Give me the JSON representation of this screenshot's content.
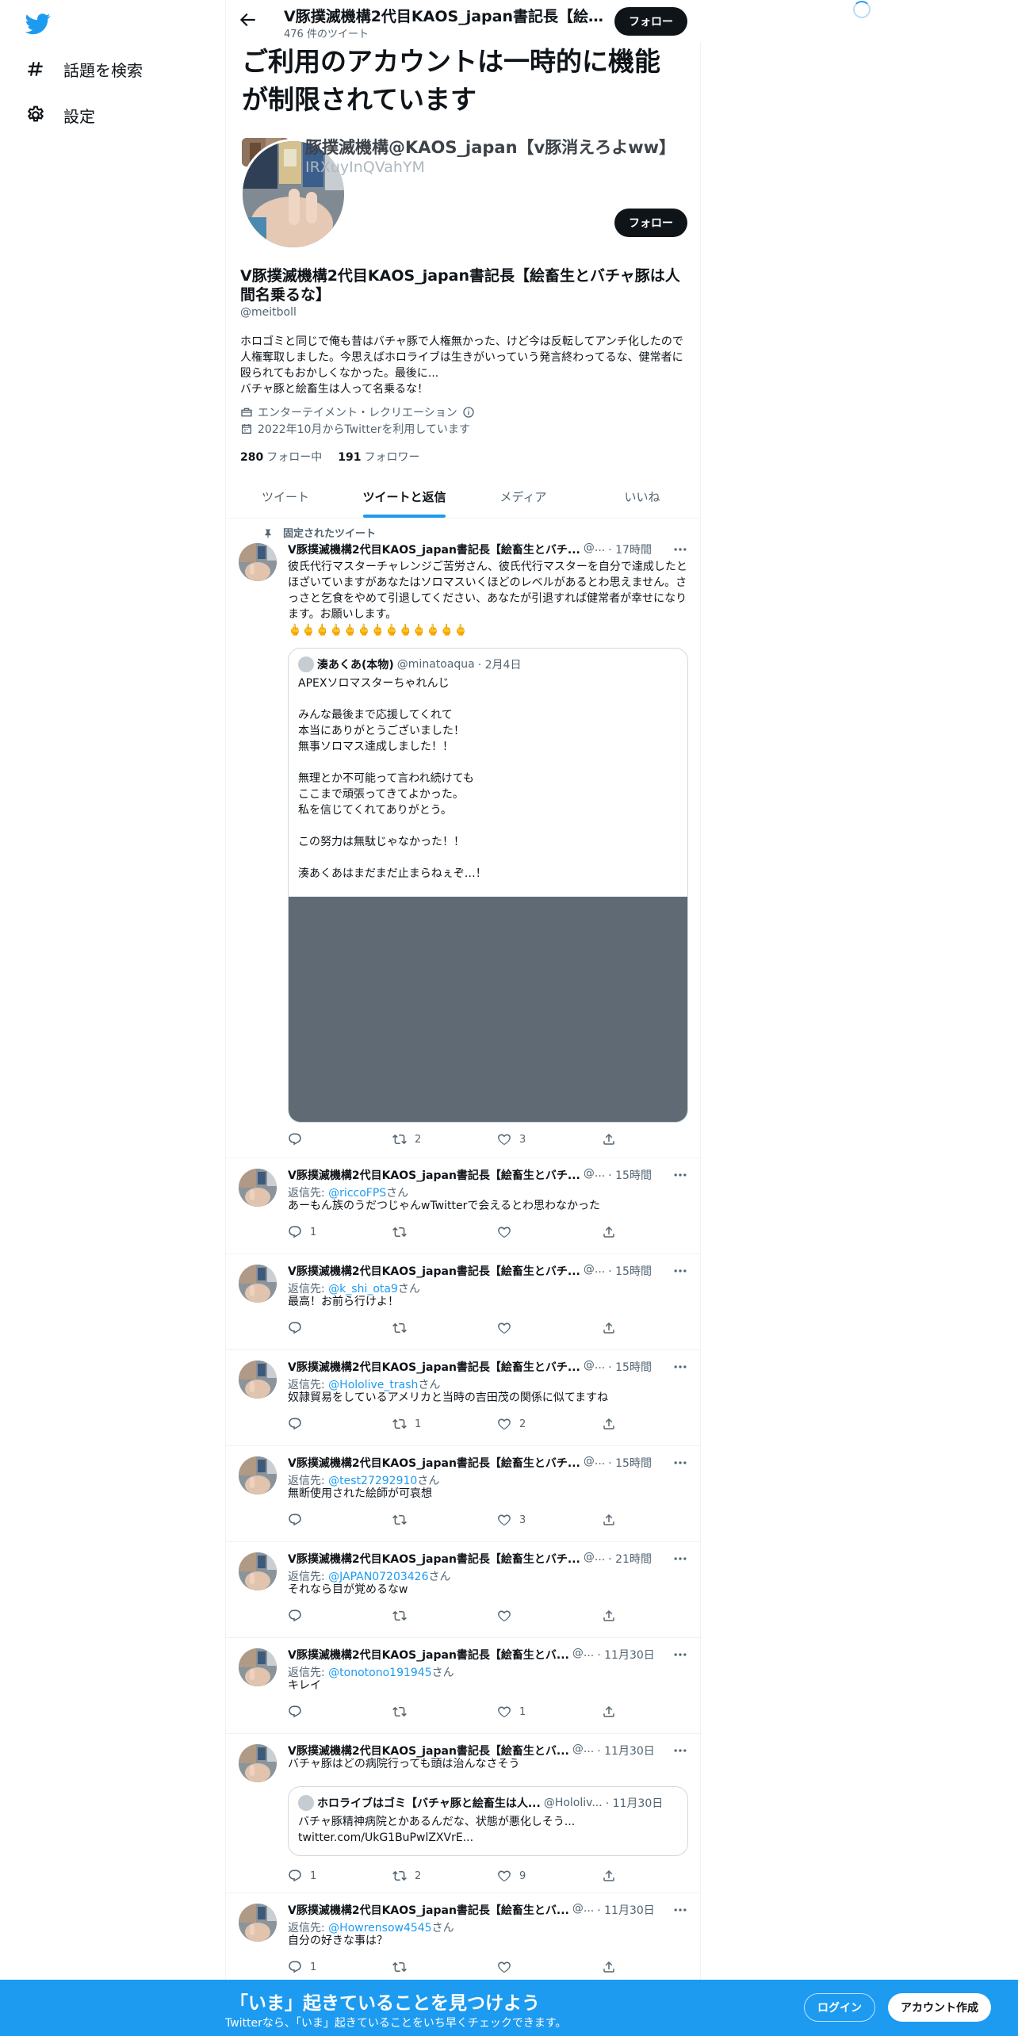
{
  "nav": {
    "items": [
      {
        "label": "話題を検索",
        "icon": "hashtag-icon"
      },
      {
        "label": "設定",
        "icon": "gear-icon"
      }
    ]
  },
  "header": {
    "title": "V豚撲滅機構2代目KAOS_japan書記長【絵畜...",
    "tweet_count": "476 件のツイート",
    "follow_label": "フォロー"
  },
  "restriction": {
    "text": "ご利用のアカウントは一時的に機能が制限されています"
  },
  "profile": {
    "overlay_name": "豚撲滅機構@KAOS_japan【v豚消えろよww】",
    "overlay_handle": "IRXuyInQVahYM",
    "follow_label": "フォロー",
    "display_name": "V豚撲滅機構2代目KAOS_japan書記長【絵畜生とバチャ豚は人間名乗るな】",
    "handle": "@meitboll",
    "bio": "ホロゴミと同じで俺も昔はバチャ豚で人権無かった、けど今は反転してアンチ化したので人権奪取しました。今思えばホロライブは生きがいっていう発言終わってるな、健常者に殴られてもおかしくなかった。最後に...\nバチャ豚と絵畜生は人って名乗るな！",
    "category": "エンターテイメント・レクリエーション",
    "joined": "2022年10月からTwitterを利用しています",
    "following_count": "280",
    "following_label": "フォロー中",
    "followers_count": "191",
    "followers_label": "フォロワー"
  },
  "tabs": [
    "ツイート",
    "ツイートと返信",
    "メディア",
    "いいね"
  ],
  "pinned_label": "固定されたツイート",
  "tweets": [
    {
      "name": "V豚撲滅機構2代目KAOS_japan書記長【絵畜生とバチ...",
      "handle": "@...",
      "time": "· 17時間",
      "text": "彼氏代行マスターチャレンジご苦労さん、彼氏代行マスターを自分で達成したとほざいていますがあなたはソロマスいくほどのレベルがあるとわ思えません。さっさと乞食をやめて引退してください、あなたが引退すれば健常者が幸せになります。お願いします。\n🖕🖕🖕🖕🖕🖕🖕🖕🖕🖕🖕🖕🖕",
      "quote": {
        "name": "湊あくあ(本物)",
        "handle": "@minatoaqua",
        "time": "· 2月4日",
        "text": "APEXソロマスターちゃれんじ\n\nみんな最後まで応援してくれて\n本当にありがとうございました！\n無事ソロマス達成しました！！\n\n無理とか不可能って言われ続けても\nここまで頑張ってきてよかった。\n私を信じてくれてありがとう。\n\nこの努力は無駄じゃなかった！！\n\n湊あくあはまだまだ止まらねぇぞ…！"
      },
      "replies": "",
      "retweets": "2",
      "likes": "3"
    },
    {
      "name": "V豚撲滅機構2代目KAOS_japan書記長【絵畜生とバチ...",
      "handle": "@...",
      "time": "· 15時間",
      "reply_prefix": "返信先: ",
      "reply_to": "@riccoFPS",
      "reply_suffix": "さん",
      "text": "あーもん族のうだつじゃんwTwitterで会えるとわ思わなかった",
      "replies": "1",
      "retweets": "",
      "likes": ""
    },
    {
      "name": "V豚撲滅機構2代目KAOS_japan書記長【絵畜生とバチ...",
      "handle": "@...",
      "time": "· 15時間",
      "reply_prefix": "返信先: ",
      "reply_to": "@k_shi_ota9",
      "reply_suffix": "さん",
      "text": "最高！お前ら行けよ！",
      "replies": "",
      "retweets": "",
      "likes": ""
    },
    {
      "name": "V豚撲滅機構2代目KAOS_japan書記長【絵畜生とバチ...",
      "handle": "@...",
      "time": "· 15時間",
      "reply_prefix": "返信先: ",
      "reply_to": "@Hololive_trash",
      "reply_suffix": "さん",
      "text": "奴隷貿易をしているアメリカと当時の吉田茂の関係に似てますね",
      "replies": "",
      "retweets": "1",
      "likes": "2"
    },
    {
      "name": "V豚撲滅機構2代目KAOS_japan書記長【絵畜生とバチ...",
      "handle": "@...",
      "time": "· 15時間",
      "reply_prefix": "返信先: ",
      "reply_to": "@test27292910",
      "reply_suffix": "さん",
      "text": "無断使用された絵師が可哀想",
      "replies": "",
      "retweets": "",
      "likes": "3"
    },
    {
      "name": "V豚撲滅機構2代目KAOS_japan書記長【絵畜生とバチ...",
      "handle": "@...",
      "time": "· 21時間",
      "reply_prefix": "返信先: ",
      "reply_to": "@JAPAN07203426",
      "reply_suffix": "さん",
      "text": "それなら目が覚めるなw",
      "replies": "",
      "retweets": "",
      "likes": ""
    },
    {
      "name": "V豚撲滅機構2代目KAOS_japan書記長【絵畜生とバ...",
      "handle": "@...",
      "time": "· 11月30日",
      "reply_prefix": "返信先: ",
      "reply_to": "@tonotono191945",
      "reply_suffix": "さん",
      "text": "キレイ",
      "replies": "",
      "retweets": "",
      "likes": "1"
    },
    {
      "name": "V豚撲滅機構2代目KAOS_japan書記長【絵畜生とバ...",
      "handle": "@...",
      "time": "· 11月30日",
      "text": "バチャ豚はどの病院行っても頭は治んなさそう",
      "quote": {
        "name": "ホロライブはゴミ【バチャ豚と絵畜生は人...",
        "handle": "@Hololiv...",
        "time": "· 11月30日",
        "text": "バチャ豚精神病院とかあるんだな、状態が悪化しそう...\ntwitter.com/UkG1BuPwlZXVrE..."
      },
      "replies": "1",
      "retweets": "2",
      "likes": "9"
    },
    {
      "name": "V豚撲滅機構2代目KAOS_japan書記長【絵畜生とバ...",
      "handle": "@...",
      "time": "· 11月30日",
      "reply_prefix": "返信先: ",
      "reply_to": "@Howrensow4545",
      "reply_suffix": "さん",
      "text": "自分の好きな事は？",
      "replies": "1",
      "retweets": "",
      "likes": ""
    }
  ],
  "bottom": {
    "title": "「いま」起きていることを見つけよう",
    "subtitle": "Twitterなら、「いま」起きていることをいち早くチェックできます。",
    "login": "ログイン",
    "signup": "アカウント作成"
  },
  "colors": {
    "accent": "#1d9bf0",
    "text": "#0f1419",
    "muted": "#536471"
  }
}
